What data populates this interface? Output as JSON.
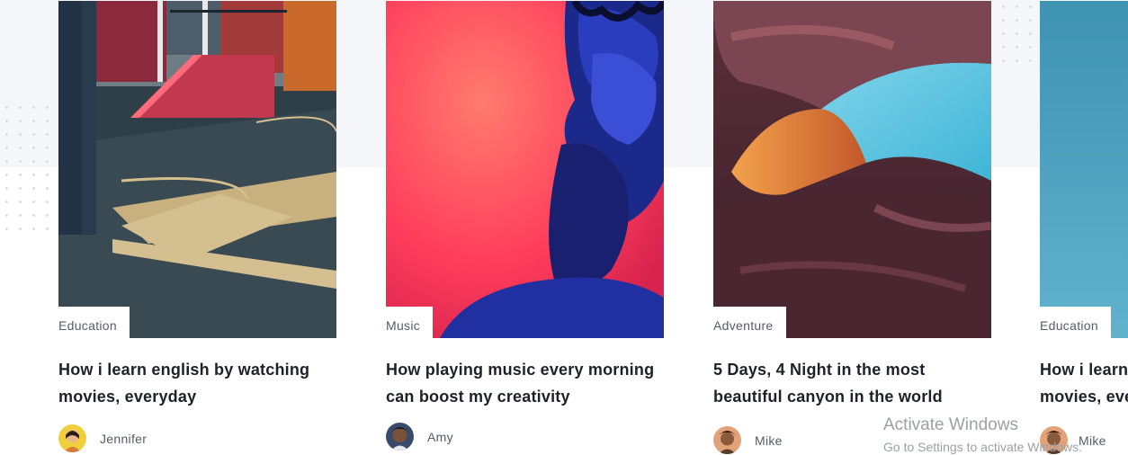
{
  "cards": [
    {
      "category": "Education",
      "title_line1": "How i learn english by watching",
      "title_line2": "movies, everyday",
      "author": "Jennifer",
      "image_name": "basketball-court-image",
      "avatar_name": "jennifer-avatar"
    },
    {
      "category": "Music",
      "title_line1": "How playing music every morning",
      "title_line2": "can boost my creativity",
      "author": "Amy",
      "image_name": "musician-portrait-image",
      "avatar_name": "amy-avatar"
    },
    {
      "category": "Adventure",
      "title_line1": "5 Days, 4 Night in the most",
      "title_line2": "beautiful canyon in the world",
      "author": "Mike",
      "image_name": "canyon-image",
      "avatar_name": "mike-avatar"
    },
    {
      "category": "Education",
      "title_line1": "How i learn english by watching",
      "title_line2": "movies, everyday",
      "author": "Mike",
      "image_name": "teal-image",
      "avatar_name": "mike-avatar-2"
    }
  ],
  "watermark": {
    "line1": "Activate Windows",
    "line2": "Go to Settings to activate Windows."
  },
  "colors": {
    "title": "#1d2129",
    "meta": "#555c68",
    "band": "#f4f6f9"
  }
}
